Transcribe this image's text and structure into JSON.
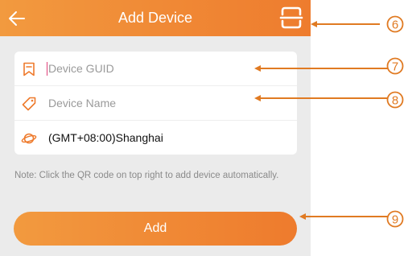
{
  "header": {
    "title": "Add Device",
    "back_icon": "arrow-left-icon",
    "scan_icon": "qr-scan-icon"
  },
  "form": {
    "guid_placeholder": "Device GUID",
    "guid_value": "",
    "guid_icon": "bookmark-icon",
    "name_placeholder": "Device Name",
    "name_value": "",
    "name_icon": "tag-icon",
    "timezone_label": "(GMT+08:00)Shanghai",
    "timezone_icon": "planet-icon"
  },
  "note": "Note: Click the QR code on top right to add device automatically.",
  "add_button_label": "Add",
  "callouts": [
    "6",
    "7",
    "8",
    "9"
  ],
  "colors": {
    "accent": "#f08a36",
    "annotation": "#e07a22",
    "background": "#ebebeb"
  }
}
